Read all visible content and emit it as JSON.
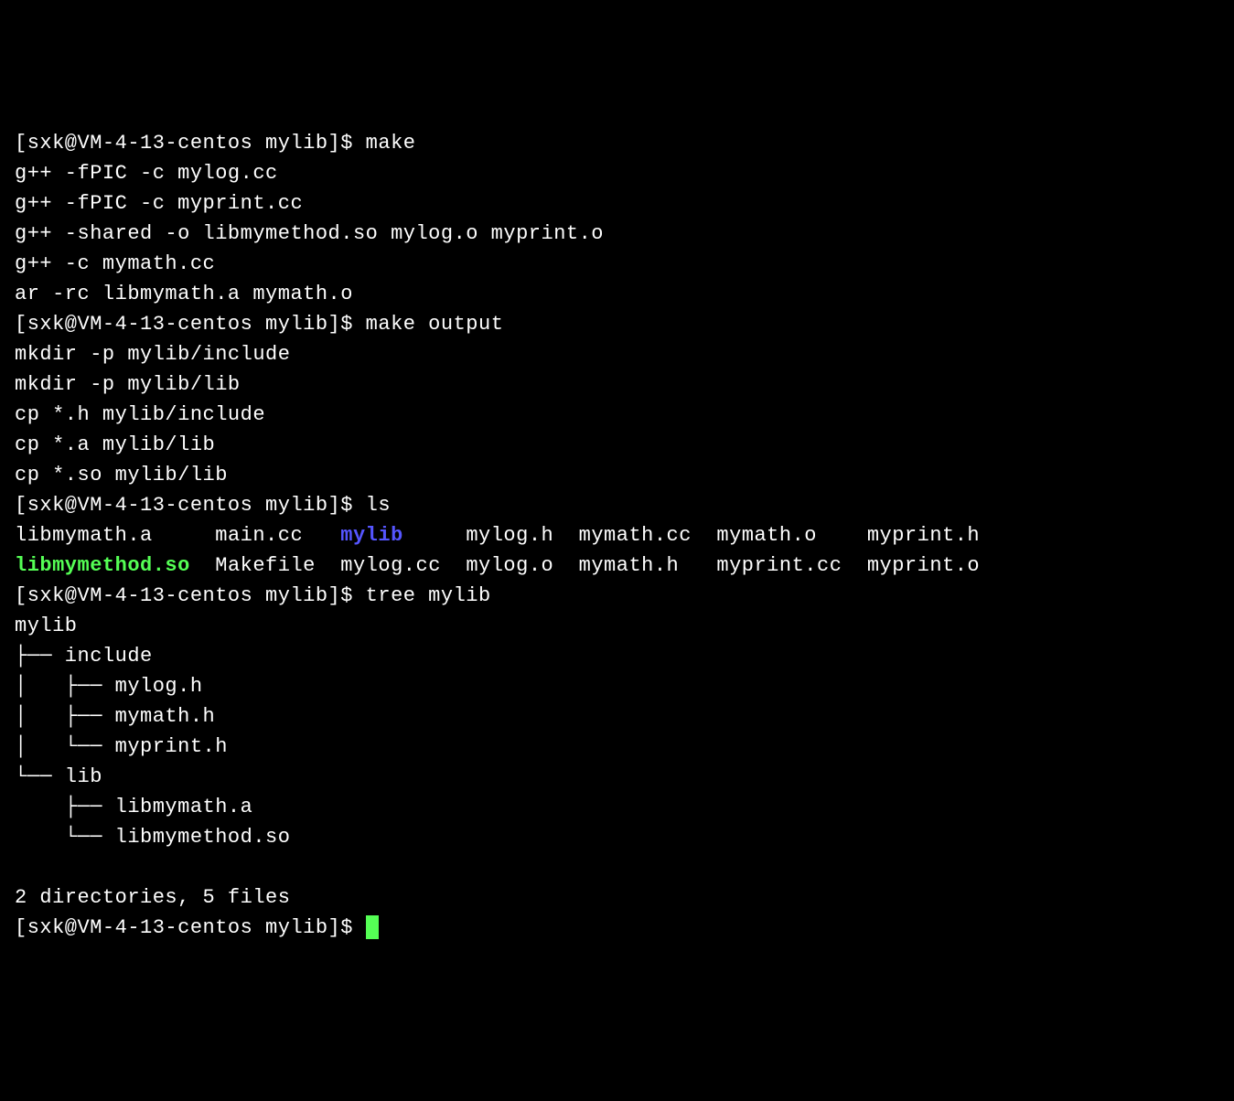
{
  "prompt": "[sxk@VM-4-13-centos mylib]$ ",
  "cmd1": "make",
  "out1_1": "g++ -fPIC -c mylog.cc",
  "out1_2": "g++ -fPIC -c myprint.cc",
  "out1_3": "g++ -shared -o libmymethod.so mylog.o myprint.o",
  "out1_4": "g++ -c mymath.cc",
  "out1_5": "ar -rc libmymath.a mymath.o",
  "cmd2": "make output",
  "out2_1": "mkdir -p mylib/include",
  "out2_2": "mkdir -p mylib/lib",
  "out2_3": "cp *.h mylib/include",
  "out2_4": "cp *.a mylib/lib",
  "out2_5": "cp *.so mylib/lib",
  "cmd3": "ls",
  "ls": {
    "r1c1": "libmymath.a",
    "r1c2": "main.cc",
    "r1c3": "mylib",
    "r1c4": "mylog.h",
    "r1c5": "mymath.cc",
    "r1c6": "mymath.o",
    "r1c7": "myprint.h",
    "r2c1": "libmymethod.so",
    "r2c2": "Makefile",
    "r2c3": "mylog.cc",
    "r2c4": "mylog.o",
    "r2c5": "mymath.h",
    "r2c6": "myprint.cc",
    "r2c7": "myprint.o"
  },
  "cmd4": "tree mylib",
  "tree_root": "mylib",
  "tree_1": "├── include",
  "tree_2": "│   ├── mylog.h",
  "tree_3": "│   ├── mymath.h",
  "tree_4": "│   └── myprint.h",
  "tree_5": "└── lib",
  "tree_6": "    ├── libmymath.a",
  "tree_7": "    └── libmymethod.so",
  "tree_summary_blank": "",
  "tree_summary": "2 directories, 5 files"
}
